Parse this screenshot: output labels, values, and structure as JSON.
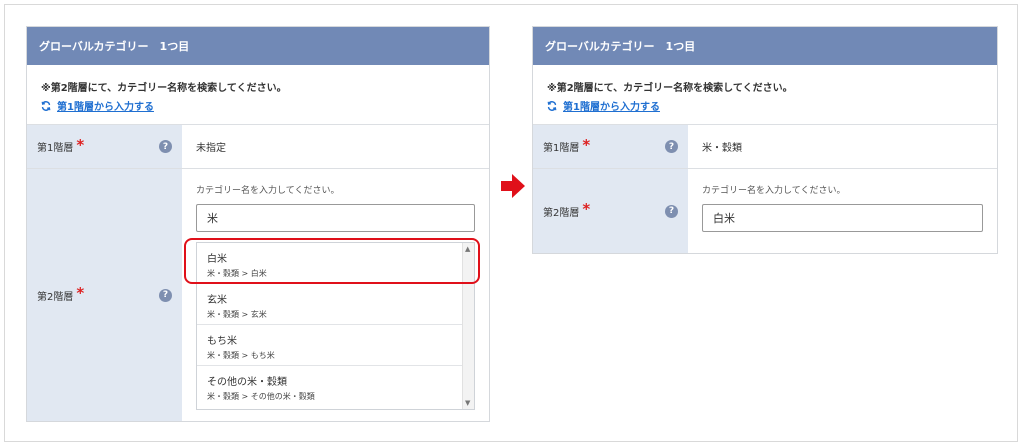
{
  "left": {
    "header": "グローバルカテゴリー　1つ目",
    "notice": "※第2階層にて、カテゴリー名称を検索してください。",
    "link": "第1階層から入力する",
    "row1_label": "第1階層",
    "row1_value": "未指定",
    "row2_label": "第2階層",
    "hint": "カテゴリー名を入力してください。",
    "input_value": "米",
    "options": [
      {
        "main": "白米",
        "sub": "米・穀類 > 白米"
      },
      {
        "main": "玄米",
        "sub": "米・穀類 > 玄米"
      },
      {
        "main": "もち米",
        "sub": "米・穀類 > もち米"
      },
      {
        "main": "その他の米・穀類",
        "sub": "米・穀類 > その他の米・穀類"
      }
    ]
  },
  "right": {
    "header": "グローバルカテゴリー　1つ目",
    "notice": "※第2階層にて、カテゴリー名称を検索してください。",
    "link": "第1階層から入力する",
    "row1_label": "第1階層",
    "row1_value": "米・穀類",
    "row2_label": "第2階層",
    "hint": "カテゴリー名を入力してください。",
    "input_value": "白米"
  },
  "help_symbol": "?",
  "required_symbol": "*",
  "colors": {
    "header": "#7189b6",
    "label_bg": "#e1e8f2",
    "link": "#1f6fd1",
    "accent_red": "#e0101a"
  }
}
